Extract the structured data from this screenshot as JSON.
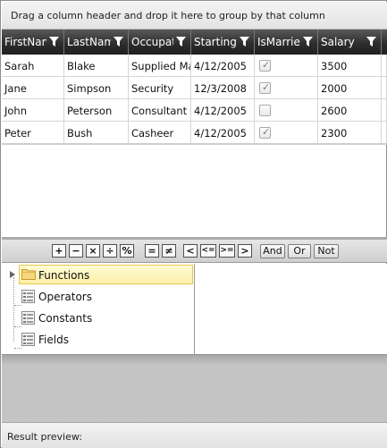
{
  "group_panel": {
    "hint": "Drag a column header and drop it here to group by that column"
  },
  "columns": [
    "FirstName",
    "LastName",
    "Occupation",
    "StartingDate",
    "IsMarried",
    "Salary"
  ],
  "rows": [
    {
      "first": "Sarah",
      "last": "Blake",
      "occupation": "Supplied Manager",
      "start": "4/12/2005",
      "married": true,
      "salary": "3500"
    },
    {
      "first": "Jane",
      "last": "Simpson",
      "occupation": "Security",
      "start": "12/3/2008",
      "married": true,
      "salary": "2000"
    },
    {
      "first": "John",
      "last": "Peterson",
      "occupation": "Consultant",
      "start": "4/12/2005",
      "married": false,
      "salary": "2600"
    },
    {
      "first": "Peter",
      "last": "Bush",
      "occupation": "Casheer",
      "start": "4/12/2005",
      "married": true,
      "salary": "2300"
    }
  ],
  "operators": {
    "plus": "+",
    "minus": "−",
    "multiply": "×",
    "divide": "÷",
    "percent": "%",
    "equal": "=",
    "not_equal": "≠",
    "less": "<",
    "less_equal": "<=",
    "greater_equal": ">=",
    "greater": ">"
  },
  "logic_buttons": {
    "and": "And",
    "or": "Or",
    "not": "Not"
  },
  "tree": {
    "items": [
      {
        "label": "Functions",
        "selected": true
      },
      {
        "label": "Operators",
        "selected": false
      },
      {
        "label": "Constants",
        "selected": false
      },
      {
        "label": "Fields",
        "selected": false
      }
    ]
  },
  "preview": {
    "label": "Result preview:"
  },
  "colors": {
    "header_bg": "#2e2e2e",
    "selection": "#fdf0a8",
    "accent_border": "#e7c84e"
  }
}
